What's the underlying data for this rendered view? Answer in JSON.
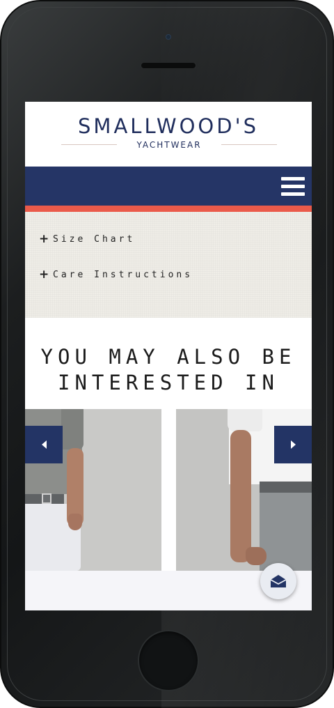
{
  "brand": {
    "name": "SMALLWOOD'S",
    "tagline": "YACHTWEAR"
  },
  "nav": {
    "menu_icon": "hamburger-menu-icon"
  },
  "product_info": {
    "links": [
      {
        "label": "Size Chart",
        "icon": "plus-icon"
      },
      {
        "label": "Care Instructions",
        "icon": "plus-icon"
      }
    ]
  },
  "related": {
    "title_line1": "YOU MAY ALSO BE",
    "title_line2": "INTERESTED IN",
    "prev_icon": "chevron-left-icon",
    "next_icon": "chevron-right-icon"
  },
  "chat": {
    "icon": "envelope-icon"
  },
  "colors": {
    "brand_navy": "#1f2d5c",
    "nav_bar": "#253566",
    "accent_coral": "#ea5a4a",
    "carousel_arrow": "#233465",
    "linen_background": "#efede7"
  }
}
